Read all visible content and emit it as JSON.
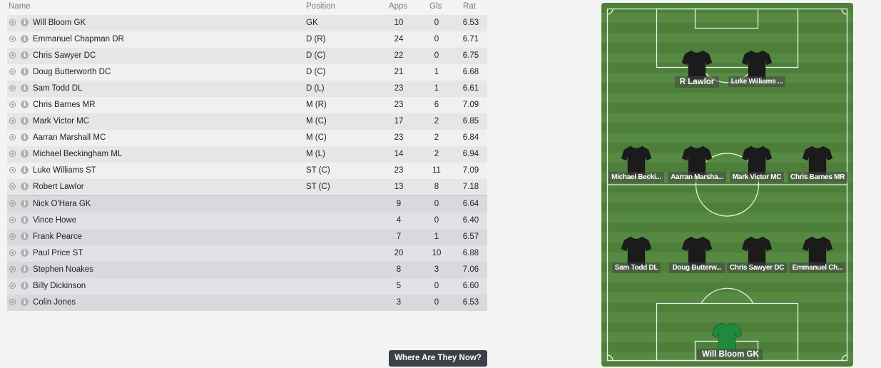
{
  "table": {
    "headers": {
      "name": "Name",
      "position": "Position",
      "apps": "Apps",
      "gls": "Gls",
      "rat": "Rat"
    },
    "rows": [
      {
        "name": "Will Bloom GK",
        "position": "GK",
        "apps": "10",
        "gls": "0",
        "rat": "6.53"
      },
      {
        "name": "Emmanuel Chapman DR",
        "position": "D (R)",
        "apps": "24",
        "gls": "0",
        "rat": "6.71"
      },
      {
        "name": "Chris Sawyer DC",
        "position": "D (C)",
        "apps": "22",
        "gls": "0",
        "rat": "6.75"
      },
      {
        "name": "Doug Butterworth DC",
        "position": "D (C)",
        "apps": "21",
        "gls": "1",
        "rat": "6.68"
      },
      {
        "name": "Sam Todd DL",
        "position": "D (L)",
        "apps": "23",
        "gls": "1",
        "rat": "6.61"
      },
      {
        "name": "Chris Barnes MR",
        "position": "M (R)",
        "apps": "23",
        "gls": "6",
        "rat": "7.09"
      },
      {
        "name": "Mark Victor MC",
        "position": "M (C)",
        "apps": "17",
        "gls": "2",
        "rat": "6.85"
      },
      {
        "name": "Aarran Marshall MC",
        "position": "M (C)",
        "apps": "23",
        "gls": "2",
        "rat": "6.84"
      },
      {
        "name": "Michael Beckingham ML",
        "position": "M (L)",
        "apps": "14",
        "gls": "2",
        "rat": "6.94"
      },
      {
        "name": "Luke Williams ST",
        "position": "ST (C)",
        "apps": "23",
        "gls": "11",
        "rat": "7.09"
      },
      {
        "name": "Robert Lawlor",
        "position": "ST (C)",
        "apps": "13",
        "gls": "8",
        "rat": "7.18"
      },
      {
        "name": "Nick O'Hara GK",
        "position": "",
        "apps": "9",
        "gls": "0",
        "rat": "6.64"
      },
      {
        "name": "Vince Howe",
        "position": "",
        "apps": "4",
        "gls": "0",
        "rat": "6.40"
      },
      {
        "name": "Frank Pearce",
        "position": "",
        "apps": "7",
        "gls": "1",
        "rat": "6.57"
      },
      {
        "name": "Paul Price ST",
        "position": "",
        "apps": "20",
        "gls": "10",
        "rat": "6.88"
      },
      {
        "name": "Stephen Noakes",
        "position": "",
        "apps": "8",
        "gls": "3",
        "rat": "7.06"
      },
      {
        "name": "Billy Dickinson",
        "position": "",
        "apps": "5",
        "gls": "0",
        "rat": "6.60"
      },
      {
        "name": "Colin Jones",
        "position": "",
        "apps": "3",
        "gls": "0",
        "rat": "6.53"
      }
    ]
  },
  "button_where": "Where Are They Now?",
  "pitch": {
    "shirt_color": "#1b1b1b",
    "gk_shirt_color": "#1f8a3c",
    "players": {
      "st1": "R Lawlor",
      "st2": "Luke Williams ...",
      "ml": "Michael Becki...",
      "mc1": "Aarran Marsha...",
      "mc2": "Mark Victor MC",
      "mr": "Chris Barnes MR",
      "dl": "Sam Todd DL",
      "dc1": "Doug Butterw...",
      "dc2": "Chris Sawyer DC",
      "dr": "Emmanuel Ch...",
      "gk": "Will Bloom GK"
    }
  }
}
